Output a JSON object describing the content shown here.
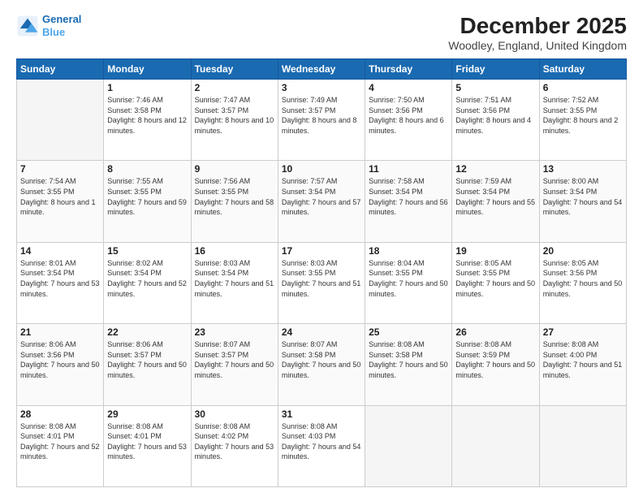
{
  "logo": {
    "line1": "General",
    "line2": "Blue"
  },
  "title": "December 2025",
  "subtitle": "Woodley, England, United Kingdom",
  "weekdays": [
    "Sunday",
    "Monday",
    "Tuesday",
    "Wednesday",
    "Thursday",
    "Friday",
    "Saturday"
  ],
  "weeks": [
    [
      {
        "day": "",
        "empty": true
      },
      {
        "day": "1",
        "sunrise": "7:46 AM",
        "sunset": "3:58 PM",
        "daylight": "8 hours and 12 minutes."
      },
      {
        "day": "2",
        "sunrise": "7:47 AM",
        "sunset": "3:57 PM",
        "daylight": "8 hours and 10 minutes."
      },
      {
        "day": "3",
        "sunrise": "7:49 AM",
        "sunset": "3:57 PM",
        "daylight": "8 hours and 8 minutes."
      },
      {
        "day": "4",
        "sunrise": "7:50 AM",
        "sunset": "3:56 PM",
        "daylight": "8 hours and 6 minutes."
      },
      {
        "day": "5",
        "sunrise": "7:51 AM",
        "sunset": "3:56 PM",
        "daylight": "8 hours and 4 minutes."
      },
      {
        "day": "6",
        "sunrise": "7:52 AM",
        "sunset": "3:55 PM",
        "daylight": "8 hours and 2 minutes."
      }
    ],
    [
      {
        "day": "7",
        "sunrise": "7:54 AM",
        "sunset": "3:55 PM",
        "daylight": "8 hours and 1 minute."
      },
      {
        "day": "8",
        "sunrise": "7:55 AM",
        "sunset": "3:55 PM",
        "daylight": "7 hours and 59 minutes."
      },
      {
        "day": "9",
        "sunrise": "7:56 AM",
        "sunset": "3:55 PM",
        "daylight": "7 hours and 58 minutes."
      },
      {
        "day": "10",
        "sunrise": "7:57 AM",
        "sunset": "3:54 PM",
        "daylight": "7 hours and 57 minutes."
      },
      {
        "day": "11",
        "sunrise": "7:58 AM",
        "sunset": "3:54 PM",
        "daylight": "7 hours and 56 minutes."
      },
      {
        "day": "12",
        "sunrise": "7:59 AM",
        "sunset": "3:54 PM",
        "daylight": "7 hours and 55 minutes."
      },
      {
        "day": "13",
        "sunrise": "8:00 AM",
        "sunset": "3:54 PM",
        "daylight": "7 hours and 54 minutes."
      }
    ],
    [
      {
        "day": "14",
        "sunrise": "8:01 AM",
        "sunset": "3:54 PM",
        "daylight": "7 hours and 53 minutes."
      },
      {
        "day": "15",
        "sunrise": "8:02 AM",
        "sunset": "3:54 PM",
        "daylight": "7 hours and 52 minutes."
      },
      {
        "day": "16",
        "sunrise": "8:03 AM",
        "sunset": "3:54 PM",
        "daylight": "7 hours and 51 minutes."
      },
      {
        "day": "17",
        "sunrise": "8:03 AM",
        "sunset": "3:55 PM",
        "daylight": "7 hours and 51 minutes."
      },
      {
        "day": "18",
        "sunrise": "8:04 AM",
        "sunset": "3:55 PM",
        "daylight": "7 hours and 50 minutes."
      },
      {
        "day": "19",
        "sunrise": "8:05 AM",
        "sunset": "3:55 PM",
        "daylight": "7 hours and 50 minutes."
      },
      {
        "day": "20",
        "sunrise": "8:05 AM",
        "sunset": "3:56 PM",
        "daylight": "7 hours and 50 minutes."
      }
    ],
    [
      {
        "day": "21",
        "sunrise": "8:06 AM",
        "sunset": "3:56 PM",
        "daylight": "7 hours and 50 minutes."
      },
      {
        "day": "22",
        "sunrise": "8:06 AM",
        "sunset": "3:57 PM",
        "daylight": "7 hours and 50 minutes."
      },
      {
        "day": "23",
        "sunrise": "8:07 AM",
        "sunset": "3:57 PM",
        "daylight": "7 hours and 50 minutes."
      },
      {
        "day": "24",
        "sunrise": "8:07 AM",
        "sunset": "3:58 PM",
        "daylight": "7 hours and 50 minutes."
      },
      {
        "day": "25",
        "sunrise": "8:08 AM",
        "sunset": "3:58 PM",
        "daylight": "7 hours and 50 minutes."
      },
      {
        "day": "26",
        "sunrise": "8:08 AM",
        "sunset": "3:59 PM",
        "daylight": "7 hours and 50 minutes."
      },
      {
        "day": "27",
        "sunrise": "8:08 AM",
        "sunset": "4:00 PM",
        "daylight": "7 hours and 51 minutes."
      }
    ],
    [
      {
        "day": "28",
        "sunrise": "8:08 AM",
        "sunset": "4:01 PM",
        "daylight": "7 hours and 52 minutes."
      },
      {
        "day": "29",
        "sunrise": "8:08 AM",
        "sunset": "4:01 PM",
        "daylight": "7 hours and 53 minutes."
      },
      {
        "day": "30",
        "sunrise": "8:08 AM",
        "sunset": "4:02 PM",
        "daylight": "7 hours and 53 minutes."
      },
      {
        "day": "31",
        "sunrise": "8:08 AM",
        "sunset": "4:03 PM",
        "daylight": "7 hours and 54 minutes."
      },
      {
        "day": "",
        "empty": true
      },
      {
        "day": "",
        "empty": true
      },
      {
        "day": "",
        "empty": true
      }
    ]
  ]
}
